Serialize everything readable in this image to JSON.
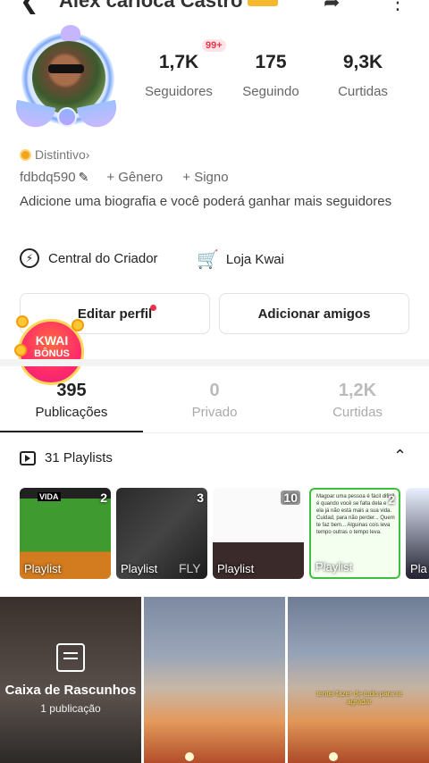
{
  "header": {
    "title": "Alex carioca Castro"
  },
  "profile": {
    "notification_badge": "99+",
    "stats": [
      {
        "value": "1,7K",
        "label": "Seguidores"
      },
      {
        "value": "175",
        "label": "Seguindo"
      },
      {
        "value": "9,3K",
        "label": "Curtidas"
      }
    ],
    "distintivo": "Distintivo",
    "user_id": "fdbdq590",
    "gender_label": "+ Gênero",
    "sign_label": "+ Signo",
    "bio": "Adicione uma biografia e você poderá ganhar mais seguidores"
  },
  "links": {
    "creator": "Central do Criador",
    "shop": "Loja Kwai"
  },
  "buttons": {
    "edit": "Editar perfil",
    "add": "Adicionar amigos"
  },
  "kwai_bonus": {
    "line1": "KWAI",
    "line2": "BÔNUS"
  },
  "tabs": [
    {
      "count": "395",
      "label": "Publicações"
    },
    {
      "count": "0",
      "label": "Privado"
    },
    {
      "count": "1,2K",
      "label": "Curtidas"
    }
  ],
  "playlists": {
    "title": "31 Playlists",
    "items": [
      {
        "count": "2",
        "label": "Playlist",
        "thumb_text": "VIDA"
      },
      {
        "count": "3",
        "label": "Playlist",
        "thumb_text": "FLY"
      },
      {
        "count": "10",
        "label": "Playlist"
      },
      {
        "count": "2",
        "label": "Playlist",
        "thumb_text": "Magoar uma pessoa é fácil difícil é quando você se falta dela e ela já não está mais a sua vida. Cuidad, para não perder... Quem te faz bem... Alguinas cois leva tempo outras o tempo leva."
      },
      {
        "count": "",
        "label": "Pla"
      }
    ]
  },
  "grid": {
    "draft_title": "Caixa de Rascunhos",
    "draft_sub": "1 publicação",
    "caption": "tentei fazer de tudo para te agradar"
  }
}
